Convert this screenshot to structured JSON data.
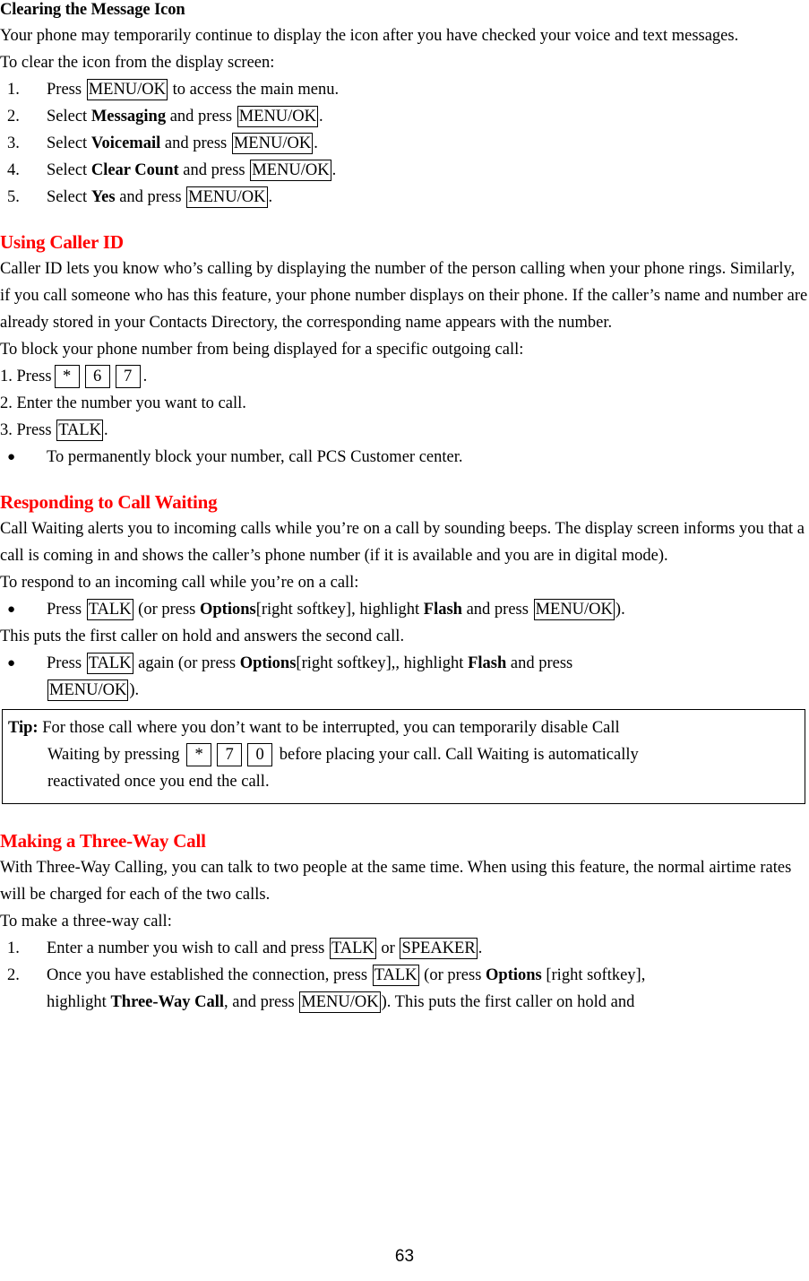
{
  "page": {
    "number": "63",
    "accent_red": "#FF0000",
    "text_color": "#000000",
    "background": "#FFFFFF"
  },
  "sections": {
    "clearing_message_icon": {
      "heading": "Clearing the Message Icon",
      "intro": "Your phone may temporarily continue to display the icon after you have checked your voice and text messages.",
      "lead_in": "To clear the icon from the display screen:",
      "steps": [
        {
          "marker": "1.",
          "pre": "Press ",
          "key": "MENU/OK",
          "post": " to access the main menu."
        },
        {
          "marker": "2.",
          "pre": "Select ",
          "bold": "Messaging",
          "mid": " and press ",
          "key": "MENU/OK",
          "post": "."
        },
        {
          "marker": "3.",
          "pre": "Select ",
          "bold": "Voicemail",
          "mid": " and press ",
          "key": "MENU/OK",
          "post": "."
        },
        {
          "marker": "4.",
          "pre": "Select ",
          "bold": "Clear Count",
          "mid": " and press ",
          "key": "MENU/OK",
          "post": "."
        },
        {
          "marker": "5.",
          "pre": "Select ",
          "bold": "Yes",
          "mid": " and press ",
          "key": "MENU/OK",
          "post": "."
        }
      ]
    },
    "using_caller_id": {
      "heading": "Using Caller ID",
      "body": "Caller ID lets you know who’s calling by displaying the number of the person calling when your phone rings. Similarly, if you call someone who has this feature, your phone number displays on their phone. If the caller’s name and number are already stored in your Contacts Directory, the corresponding name appears with the number.",
      "lead_in": "To block your phone number from being displayed for a specific outgoing call:",
      "step1": {
        "marker": "1. ",
        "pre": "Press",
        "keys": [
          "*",
          "6",
          "7"
        ],
        "post": "."
      },
      "step2": "2. Enter the number you want to call.",
      "step3": {
        "marker": "3. ",
        "pre": "Press ",
        "key": "TALK",
        "post": "."
      },
      "bullet": "To permanently block your number, call PCS Customer center."
    },
    "responding_to_call_waiting": {
      "heading": "Responding to Call Waiting",
      "body": "Call Waiting alerts you to incoming calls while you’re on a call by sounding beeps. The display screen informs you that a call is coming in and shows the caller’s phone number (if it is available and you are in digital mode).",
      "lead_in": "To respond to an incoming call while you’re on a call:",
      "bullet1": {
        "pre": "Press ",
        "key1": "TALK",
        "mid1": " (or press ",
        "bold1": "Options",
        "mid2": "[right softkey], highlight ",
        "bold2": "Flash",
        "mid3": " and press ",
        "key2": "MENU/OK",
        "post": ")."
      },
      "between": "This puts the first caller on hold and answers the second call.",
      "bullet2": {
        "pre": "Press ",
        "key1": "TALK",
        "mid1": " again (or press ",
        "bold1": "Options",
        "mid2": "[right softkey],, highlight ",
        "bold2": "Flash",
        "mid3": " and press ",
        "key2": "MENU/OK",
        "post": ")."
      },
      "tip": {
        "label": "Tip:",
        "line1": " For those call where you don’t want to be interrupted, you can temporarily disable Call",
        "line2_pre": "Waiting by pressing ",
        "keys": [
          "*",
          "7",
          "0"
        ],
        "line2_post": " before placing your call. Call Waiting is automatically",
        "line3": "reactivated once you end the call."
      }
    },
    "making_three_way_call": {
      "heading": "Making a Three-Way Call",
      "body": "With Three-Way Calling, you can talk to two people at the same time. When using this feature, the normal airtime rates will be charged for each of the two calls.",
      "lead_in": "To make a three-way call:",
      "steps": [
        {
          "marker": "1.",
          "pre": "Enter a number you wish to call and press ",
          "key1": "TALK",
          "mid": " or ",
          "key2": "SPEAKER",
          "post": "."
        },
        {
          "marker": "2.",
          "pre": "Once you have established the connection, press ",
          "key1": "TALK",
          "mid1": " (or press ",
          "bold1": "Options",
          "mid2": " [right softkey],",
          "line2_pre": "highlight ",
          "bold2": "Three-Way Call",
          "mid3": ", and press ",
          "key2": "MENU/OK",
          "post": "). This puts the first caller on hold and"
        }
      ]
    }
  }
}
